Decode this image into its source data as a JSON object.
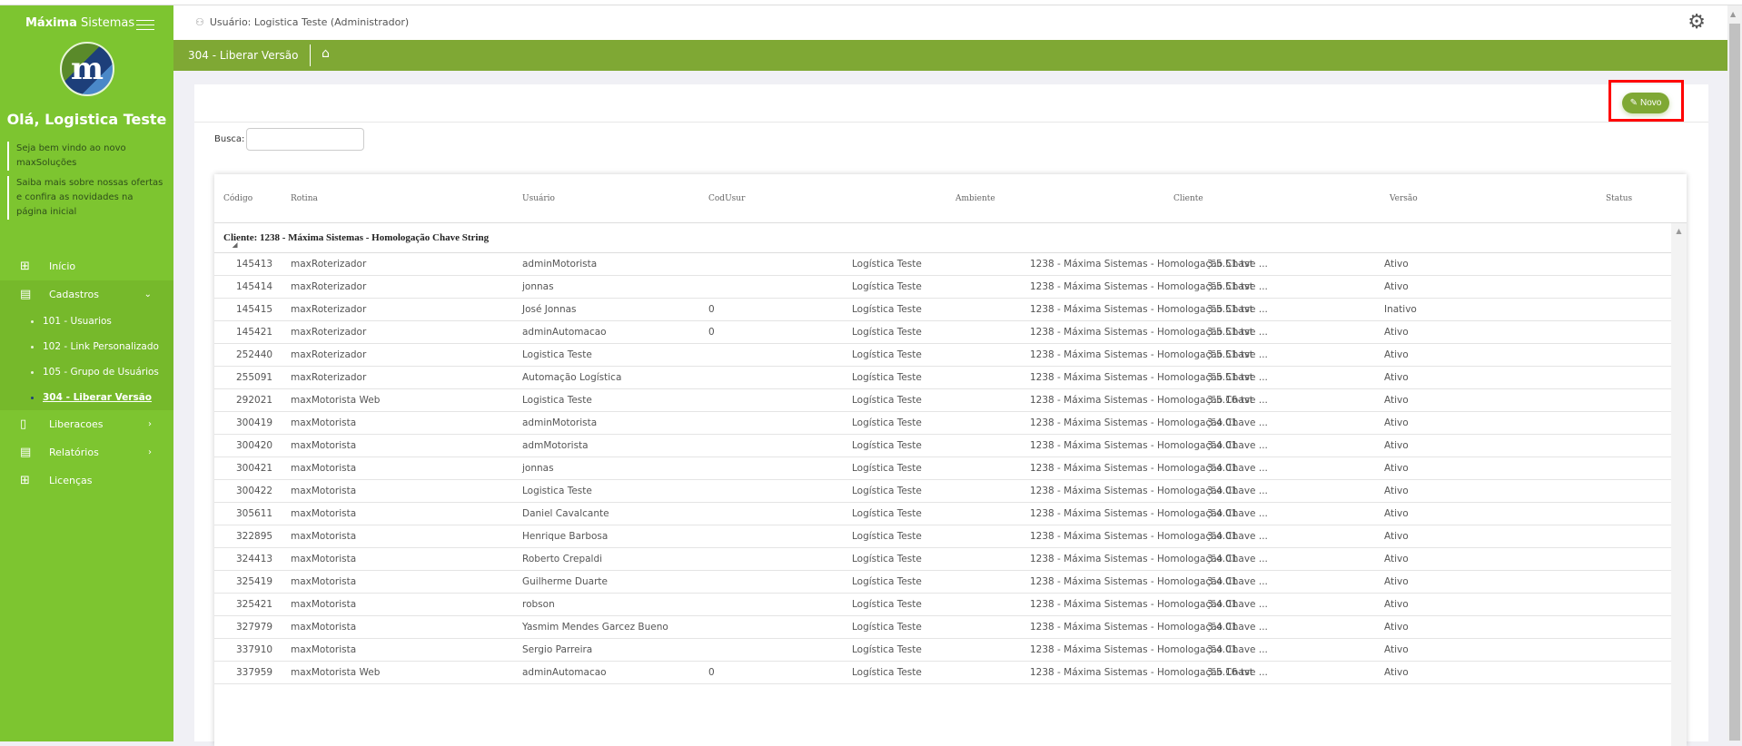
{
  "brand": {
    "bold": "Máxima",
    "rest": "Sistemas",
    "logo_letter": "m"
  },
  "sidebar": {
    "greeting": "Olá, Logistica Teste",
    "note1": "Seja bem vindo ao novo maxSoluções",
    "note2": "Saiba mais sobre nossas ofertas e confira as novidades na página inicial",
    "items": [
      {
        "label": "Início"
      },
      {
        "label": "Cadastros"
      },
      {
        "label": "Liberacoes"
      },
      {
        "label": "Relatórios"
      },
      {
        "label": "Licenças"
      }
    ],
    "subitems": [
      {
        "label": "101 - Usuarios"
      },
      {
        "label": "102 - Link Personalizado"
      },
      {
        "label": "105 - Grupo de Usuários"
      },
      {
        "label": "304 - Liberar Versão"
      }
    ]
  },
  "header": {
    "user": "Usuário: Logistica Teste (Administrador)"
  },
  "page": {
    "title": "304 - Liberar Versão",
    "novo_label": "Novo",
    "busca_label": "Busca:",
    "busca_value": ""
  },
  "table": {
    "columns": [
      "Código",
      "Rotina",
      "Usuário",
      "CodUsur",
      "Ambiente",
      "Cliente",
      "Versão",
      "Status"
    ],
    "group": "Cliente: 1238 - Máxima Sistemas - Homologação Chave String",
    "rows": [
      [
        "145413",
        "maxRoterizador",
        "adminMotorista",
        "",
        "Logística Teste",
        "1238 - Máxima Sistemas - Homologação Chave ...",
        "3.5.51-tst",
        "Ativo"
      ],
      [
        "145414",
        "maxRoterizador",
        "jonnas",
        "",
        "Logística Teste",
        "1238 - Máxima Sistemas - Homologação Chave ...",
        "3.5.51-tst",
        "Ativo"
      ],
      [
        "145415",
        "maxRoterizador",
        "José Jonnas",
        "0",
        "Logística Teste",
        "1238 - Máxima Sistemas - Homologação Chave ...",
        "3.5.51-tst",
        "Inativo"
      ],
      [
        "145421",
        "maxRoterizador",
        "adminAutomacao",
        "0",
        "Logística Teste",
        "1238 - Máxima Sistemas - Homologação Chave ...",
        "3.5.51-tst",
        "Ativo"
      ],
      [
        "252440",
        "maxRoterizador",
        "Logistica Teste",
        "",
        "Logística Teste",
        "1238 - Máxima Sistemas - Homologação Chave ...",
        "3.5.51-tst",
        "Ativo"
      ],
      [
        "255091",
        "maxRoterizador",
        "Automação Logística",
        "",
        "Logística Teste",
        "1238 - Máxima Sistemas - Homologação Chave ...",
        "3.5.51-tst",
        "Ativo"
      ],
      [
        "292021",
        "maxMotorista Web",
        "Logistica Teste",
        "",
        "Logística Teste",
        "1238 - Máxima Sistemas - Homologação Chave ...",
        "3.5.16-tst",
        "Ativo"
      ],
      [
        "300419",
        "maxMotorista",
        "adminMotorista",
        "",
        "Logística Teste",
        "1238 - Máxima Sistemas - Homologação Chave ...",
        "3.4.01",
        "Ativo"
      ],
      [
        "300420",
        "maxMotorista",
        "admMotorista",
        "",
        "Logística Teste",
        "1238 - Máxima Sistemas - Homologação Chave ...",
        "3.4.01",
        "Ativo"
      ],
      [
        "300421",
        "maxMotorista",
        "jonnas",
        "",
        "Logística Teste",
        "1238 - Máxima Sistemas - Homologação Chave ...",
        "3.4.01",
        "Ativo"
      ],
      [
        "300422",
        "maxMotorista",
        "Logistica Teste",
        "",
        "Logística Teste",
        "1238 - Máxima Sistemas - Homologação Chave ...",
        "3.4.01",
        "Ativo"
      ],
      [
        "305611",
        "maxMotorista",
        "Daniel Cavalcante",
        "",
        "Logística Teste",
        "1238 - Máxima Sistemas - Homologação Chave ...",
        "3.4.01",
        "Ativo"
      ],
      [
        "322895",
        "maxMotorista",
        "Henrique Barbosa",
        "",
        "Logística Teste",
        "1238 - Máxima Sistemas - Homologação Chave ...",
        "3.4.01",
        "Ativo"
      ],
      [
        "324413",
        "maxMotorista",
        "Roberto Crepaldi",
        "",
        "Logística Teste",
        "1238 - Máxima Sistemas - Homologação Chave ...",
        "3.4.01",
        "Ativo"
      ],
      [
        "325419",
        "maxMotorista",
        "Guilherme Duarte",
        "",
        "Logística Teste",
        "1238 - Máxima Sistemas - Homologação Chave ...",
        "3.4.01",
        "Ativo"
      ],
      [
        "325421",
        "maxMotorista",
        "robson",
        "",
        "Logística Teste",
        "1238 - Máxima Sistemas - Homologação Chave ...",
        "3.4.01",
        "Ativo"
      ],
      [
        "327979",
        "maxMotorista",
        "Yasmim Mendes Garcez Bueno",
        "",
        "Logística Teste",
        "1238 - Máxima Sistemas - Homologação Chave ...",
        "3.4.01",
        "Ativo"
      ],
      [
        "337910",
        "maxMotorista",
        "Sergio Parreira",
        "",
        "Logística Teste",
        "1238 - Máxima Sistemas - Homologação Chave ...",
        "3.4.01",
        "Ativo"
      ],
      [
        "337959",
        "maxMotorista Web",
        "adminAutomacao",
        "0",
        "Logística Teste",
        "1238 - Máxima Sistemas - Homologação Chave ...",
        "3.5.16-tst",
        "Ativo"
      ]
    ]
  }
}
